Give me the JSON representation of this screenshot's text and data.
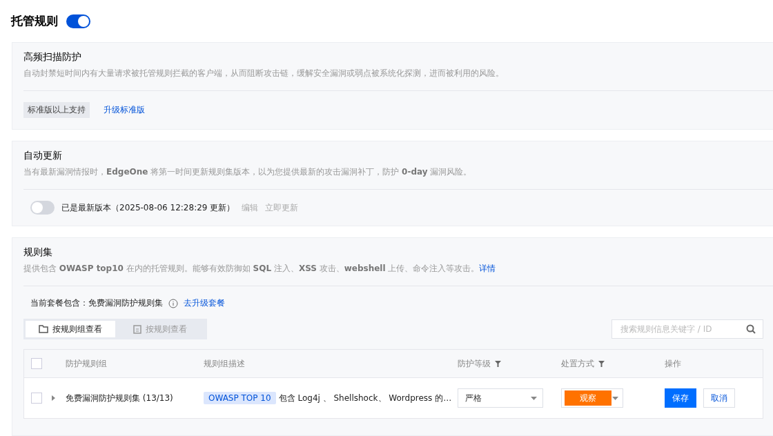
{
  "header": {
    "title": "托管规则",
    "on": true
  },
  "scan": {
    "title": "高频扫描防护",
    "description": "自动封禁短时间内有大量请求被托管规则拦截的客户端，从而阻断攻击链，缓解安全漏洞或弱点被系统化探测，进而被利用的风险。",
    "badge": "标准版以上支持",
    "link": "升级标准版"
  },
  "update": {
    "title": "自动更新",
    "description": "当有最新漏洞情报时，**EdgeOne** 将第一时间更新规则集版本，以为您提供最新的攻击漏洞补丁，防护 **0-day** 漏洞风险。",
    "on": false,
    "status": "已是最新版本（2025-08-06 12:28:29 更新）",
    "actions": [
      "编辑",
      "立即更新"
    ]
  },
  "ruleset": {
    "title": "规则集",
    "description": "提供包含 **OWASP top10** 在内的托管规则。能够有效防御如 **SQL** 注入、**XSS** 攻击、**webshell** 上传、命令注入等攻击。",
    "detail_link": "详情",
    "plan_label": "当前套餐包含：免费漏洞防护规则集",
    "upgrade_link": "去升级套餐",
    "tabs": [
      {
        "label": "按规则组查看",
        "selected": true
      },
      {
        "label": "按规则查看",
        "selected": false
      }
    ],
    "select_all_checked": false,
    "search": {
      "placeholder": "搜索规则信息关键字 / ID"
    },
    "columns": [
      {
        "label": "防护规则组",
        "filter": false
      },
      {
        "label": "规则组描述",
        "filter": false
      },
      {
        "label": "防护等级",
        "filter": true
      },
      {
        "label": "处置方式",
        "filter": true
      },
      {
        "label": "操作",
        "filter": false
      }
    ],
    "rows": [
      {
        "checked": false,
        "name": "免费漏洞防护规则集 (13/13)",
        "tag": "OWASP TOP 10",
        "description": "包含 Log4j 、 Shellshock、 Wordpress 的…",
        "level": "严格",
        "action": "观察",
        "buttons": [
          "保存",
          "取消"
        ]
      }
    ]
  }
}
